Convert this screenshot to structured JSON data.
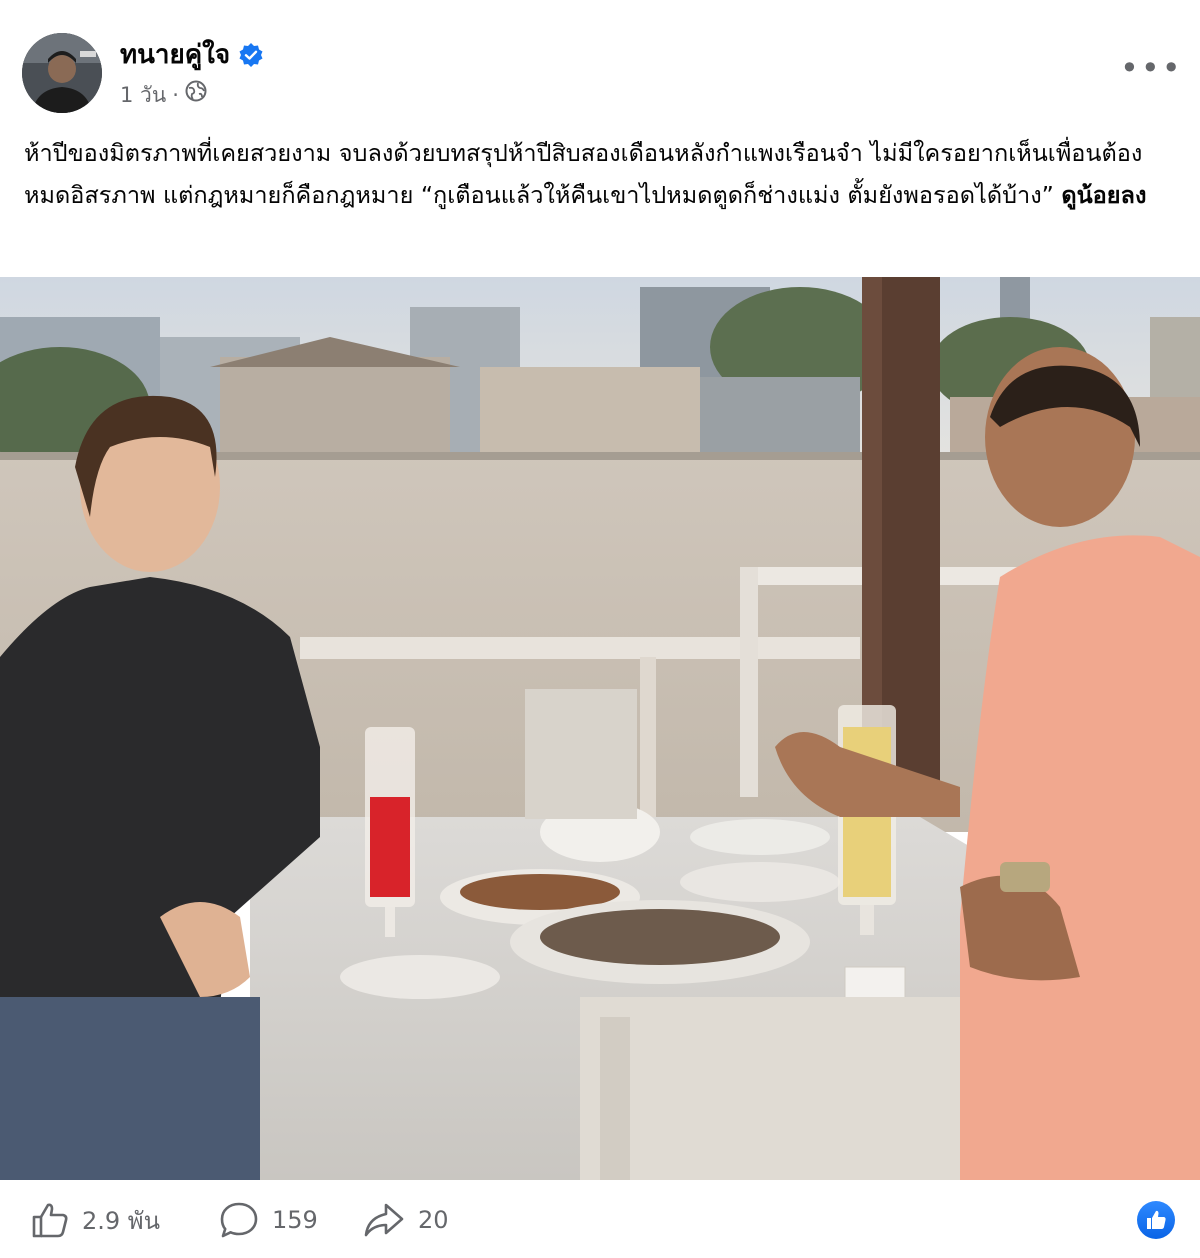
{
  "post": {
    "author": "ทนายคู่ใจ",
    "time": "1 วัน",
    "dot": "·",
    "verified_icon": "verified-badge-icon",
    "privacy_icon": "globe-icon",
    "more_icon": "more-options-icon",
    "more_label": "•••",
    "caption_text": "ห้าปีของมิตรภาพที่เคยสวยงาม จบลงด้วยบทสรุปห้าปีสิบสองเดือนหลังกำแพงเรือนจำ ไม่มีใครอยากเห็นเพื่อนต้องหมดอิสรภาพ แต่กฎหมายก็คือกฎหมาย “กูเตือนแล้วให้คืนเขาไปหมดตูดก็ช่างแม่ง ตั้มยังพอรอดได้บ้าง”",
    "see_more": "ดูน้อยลง"
  },
  "reactions": {
    "likes": "2.9 พัน",
    "comments": "159",
    "shares": "20",
    "like_icon": "thumbs-up-icon",
    "comment_icon": "comment-icon",
    "share_icon": "share-arrow-icon",
    "badge_icon": "like-badge-icon"
  },
  "colors": {
    "accent": "#1877f2",
    "secondary_text": "#65676b"
  }
}
